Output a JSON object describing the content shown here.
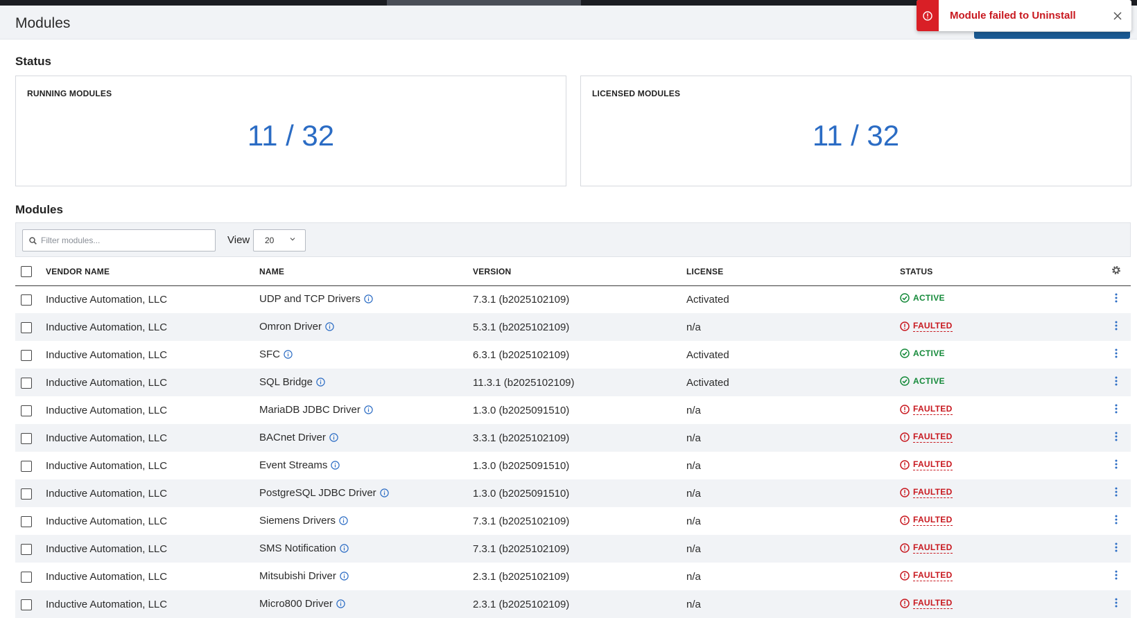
{
  "header": {
    "title": "Modules"
  },
  "toast": {
    "message": "Module failed to Uninstall",
    "color": "#d91f26"
  },
  "status_section": {
    "title": "Status",
    "cards": [
      {
        "label": "RUNNING MODULES",
        "value": "11 / 32"
      },
      {
        "label": "LICENSED MODULES",
        "value": "11 / 32"
      }
    ]
  },
  "modules_section": {
    "title": "Modules",
    "search_placeholder": "Filter modules...",
    "view_label": "View",
    "view_value": "20",
    "columns": [
      "VENDOR NAME",
      "NAME",
      "VERSION",
      "LICENSE",
      "STATUS"
    ],
    "rows": [
      {
        "vendor": "Inductive Automation, LLC",
        "name": "UDP and TCP Drivers",
        "version": "7.3.1 (b2025102109)",
        "license": "Activated",
        "status": "ACTIVE"
      },
      {
        "vendor": "Inductive Automation, LLC",
        "name": "Omron Driver",
        "version": "5.3.1 (b2025102109)",
        "license": "n/a",
        "status": "FAULTED"
      },
      {
        "vendor": "Inductive Automation, LLC",
        "name": "SFC",
        "version": "6.3.1 (b2025102109)",
        "license": "Activated",
        "status": "ACTIVE"
      },
      {
        "vendor": "Inductive Automation, LLC",
        "name": "SQL Bridge",
        "version": "11.3.1 (b2025102109)",
        "license": "Activated",
        "status": "ACTIVE"
      },
      {
        "vendor": "Inductive Automation, LLC",
        "name": "MariaDB JDBC Driver",
        "version": "1.3.0 (b2025091510)",
        "license": "n/a",
        "status": "FAULTED"
      },
      {
        "vendor": "Inductive Automation, LLC",
        "name": "BACnet Driver",
        "version": "3.3.1 (b2025102109)",
        "license": "n/a",
        "status": "FAULTED"
      },
      {
        "vendor": "Inductive Automation, LLC",
        "name": "Event Streams",
        "version": "1.3.0 (b2025091510)",
        "license": "n/a",
        "status": "FAULTED"
      },
      {
        "vendor": "Inductive Automation, LLC",
        "name": "PostgreSQL JDBC Driver",
        "version": "1.3.0 (b2025091510)",
        "license": "n/a",
        "status": "FAULTED"
      },
      {
        "vendor": "Inductive Automation, LLC",
        "name": "Siemens Drivers",
        "version": "7.3.1 (b2025102109)",
        "license": "n/a",
        "status": "FAULTED"
      },
      {
        "vendor": "Inductive Automation, LLC",
        "name": "SMS Notification",
        "version": "7.3.1 (b2025102109)",
        "license": "n/a",
        "status": "FAULTED"
      },
      {
        "vendor": "Inductive Automation, LLC",
        "name": "Mitsubishi Driver",
        "version": "2.3.1 (b2025102109)",
        "license": "n/a",
        "status": "FAULTED"
      },
      {
        "vendor": "Inductive Automation, LLC",
        "name": "Micro800 Driver",
        "version": "2.3.1 (b2025102109)",
        "license": "n/a",
        "status": "FAULTED"
      }
    ]
  },
  "colors": {
    "accent": "#2b6cc4",
    "active": "#158a3a",
    "faulted": "#c8181f"
  }
}
